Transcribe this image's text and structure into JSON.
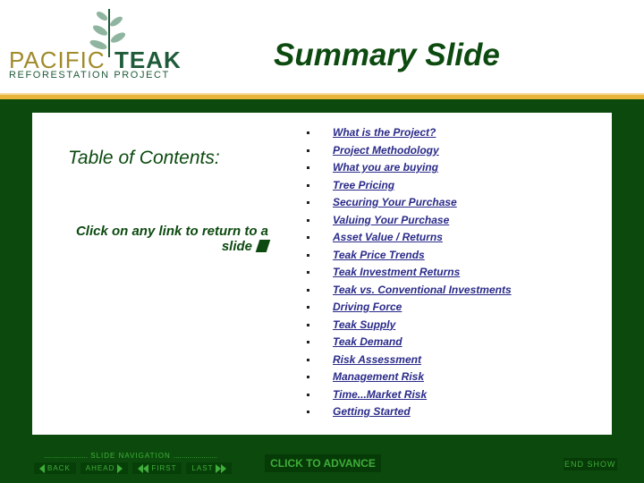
{
  "logo": {
    "word1": "Pacific",
    "word2": "Teak",
    "subtitle": "REFORESTATION PROJECT"
  },
  "header": {
    "title": "Summary Slide"
  },
  "toc": {
    "heading": "Table of Contents:",
    "hint": "Click on any link to return to a slide",
    "items": [
      {
        "label": "What is the Project?"
      },
      {
        "label": "Project Methodology"
      },
      {
        "label": "What you are buying"
      },
      {
        "label": "Tree Pricing"
      },
      {
        "label": "Securing Your Purchase"
      },
      {
        "label": "Valuing Your Purchase"
      },
      {
        "label": "Asset Value / Returns"
      },
      {
        "label": "Teak Price Trends"
      },
      {
        "label": "Teak Investment Returns"
      },
      {
        "label": "Teak vs. Conventional Investments"
      },
      {
        "label": "Driving Force"
      },
      {
        "label": "Teak Supply"
      },
      {
        "label": "Teak Demand"
      },
      {
        "label": "Risk Assessment"
      },
      {
        "label": "Management Risk"
      },
      {
        "label": "Time...Market Risk"
      },
      {
        "label": "Getting Started"
      }
    ]
  },
  "navigation": {
    "caption": "SLIDE NAVIGATION",
    "dots": "......................",
    "back": "BACK",
    "ahead": "AHEAD",
    "first": "FIRST",
    "last": "LAST",
    "advance": "CLICK TO ADVANCE",
    "end_show": "END SHOW"
  },
  "colors": {
    "frame_green": "#0b4a0c",
    "accent_gold": "#e8b53a",
    "link_blue": "#2a2a8a",
    "title_green": "#0d4a10",
    "nav_text": "#3fae3a"
  }
}
